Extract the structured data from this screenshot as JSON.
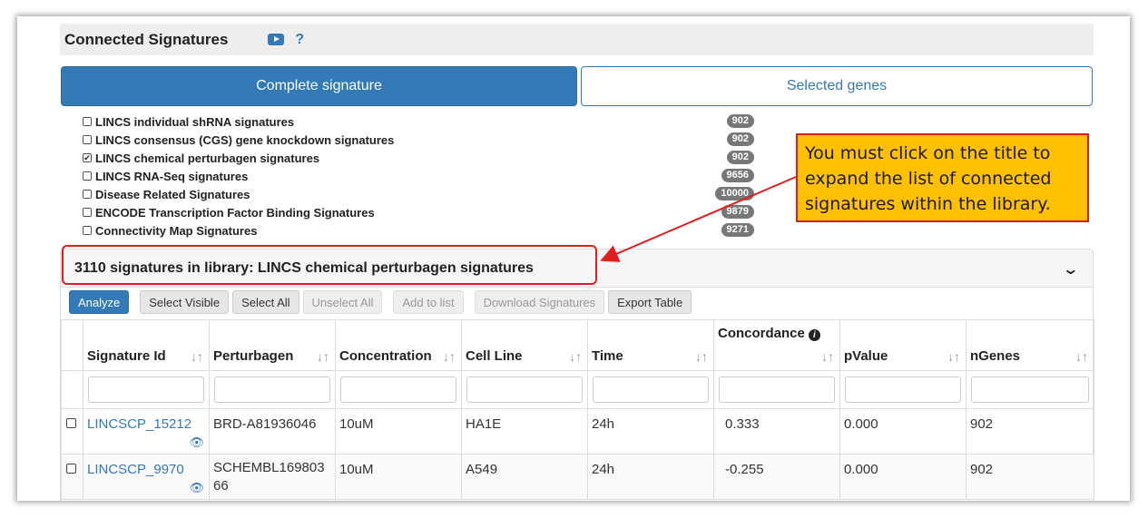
{
  "header": {
    "title": "Connected Signatures",
    "help": "?"
  },
  "tabs": [
    {
      "label": "Complete signature",
      "active": true
    },
    {
      "label": "Selected genes",
      "active": false
    }
  ],
  "libraries": [
    {
      "label": "LINCS individual shRNA signatures",
      "count": "902",
      "checked": false
    },
    {
      "label": "LINCS consensus (CGS) gene knockdown signatures",
      "count": "902",
      "checked": false
    },
    {
      "label": "LINCS chemical perturbagen signatures",
      "count": "902",
      "checked": true
    },
    {
      "label": "LINCS RNA-Seq signatures",
      "count": "9656",
      "checked": false
    },
    {
      "label": "Disease Related Signatures",
      "count": "10000",
      "checked": false
    },
    {
      "label": "ENCODE Transcription Factor Binding Signatures",
      "count": "9879",
      "checked": false
    },
    {
      "label": "Connectivity Map Signatures",
      "count": "9271",
      "checked": false
    }
  ],
  "callout": {
    "text": "You must click on the title to expand the list of connected signatures within the library."
  },
  "panel": {
    "title": "3110 signatures in library: LINCS chemical perturbagen signatures"
  },
  "toolbar": {
    "analyze": "Analyze",
    "select_visible": "Select Visible",
    "select_all": "Select All",
    "unselect_all": "Unselect All",
    "add_to_list": "Add to list",
    "download": "Download Signatures",
    "export": "Export Table"
  },
  "table": {
    "columns": [
      "Signature Id",
      "Perturbagen",
      "Concentration",
      "Cell Line",
      "Time",
      "Concordance",
      "pValue",
      "nGenes"
    ],
    "rows": [
      [
        "LINCSCP_15212",
        "BRD-A81936046",
        "10uM",
        "HA1E",
        "24h",
        "0.333",
        "0.000",
        "902"
      ],
      [
        "LINCSCP_9970",
        "SCHEMBL16980366",
        "10uM",
        "A549",
        "24h",
        "-0.255",
        "0.000",
        "902"
      ]
    ]
  },
  "colors": {
    "primary": "#337ab7",
    "callout_bg": "#ffc000",
    "highlight": "#e01e1e"
  }
}
